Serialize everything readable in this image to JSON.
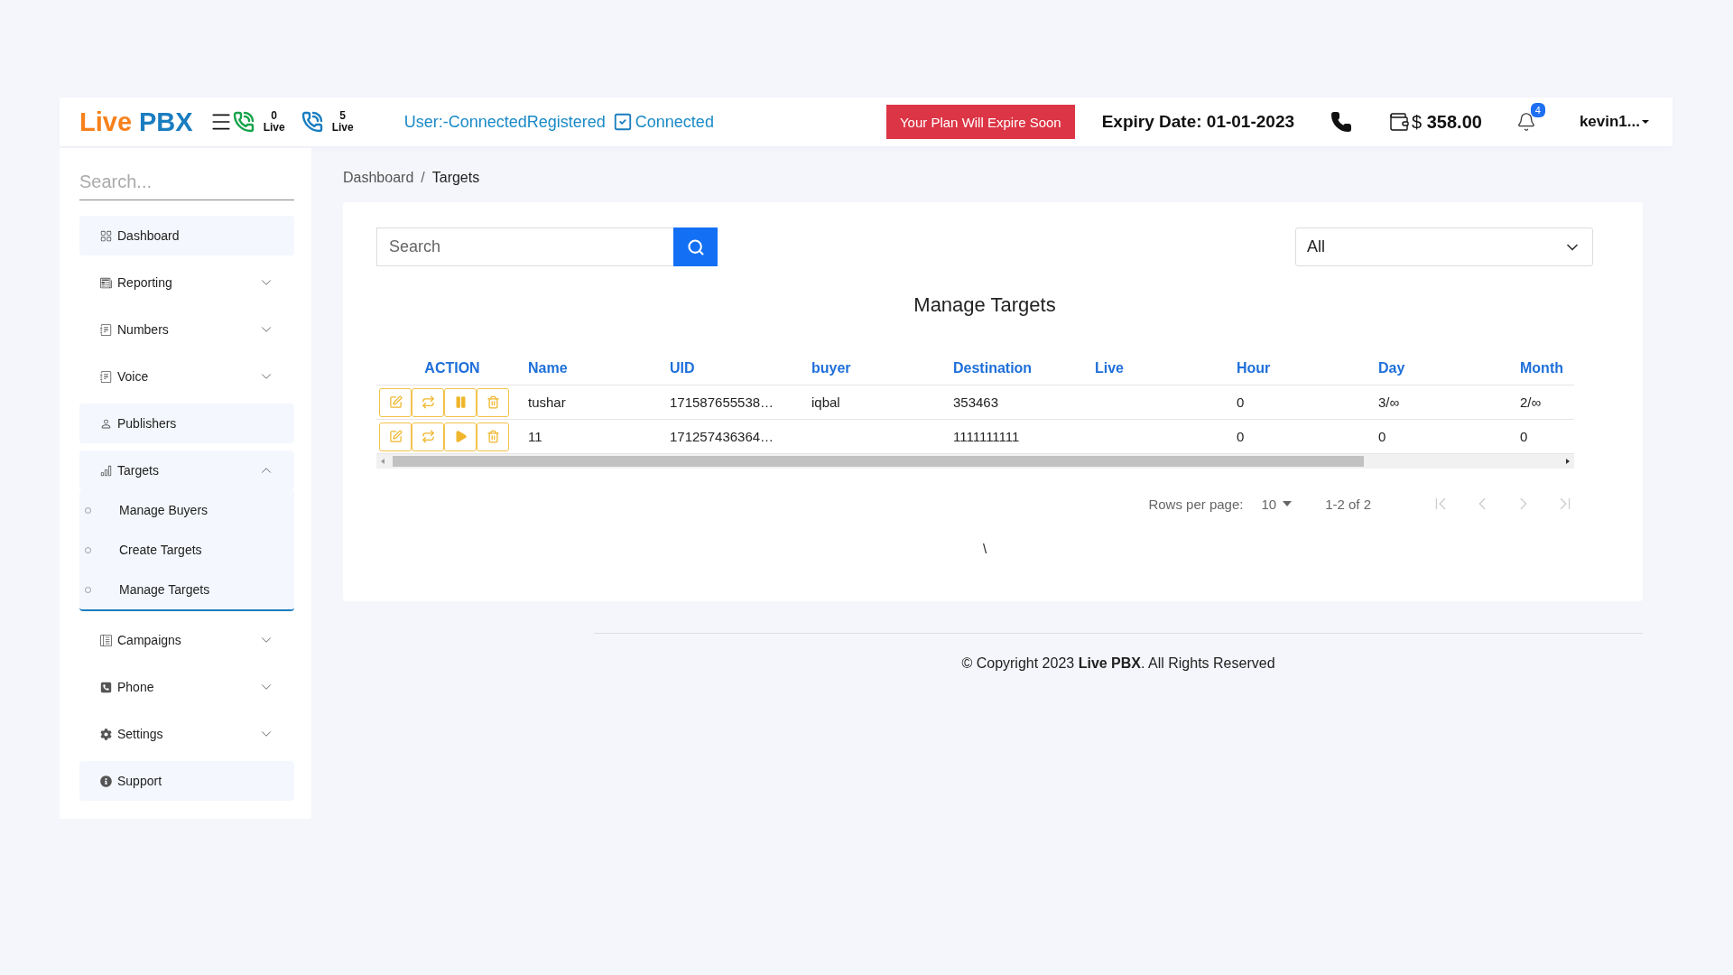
{
  "header": {
    "logo": [
      {
        "text": "Live",
        "kind": "accent"
      },
      {
        "text": "PBX",
        "kind": "main"
      }
    ],
    "live_counters": [
      {
        "count": "0",
        "label": "Live",
        "kind": "incoming"
      },
      {
        "count": "5",
        "label": "Live",
        "kind": "outgoing"
      }
    ],
    "status_text": "User:-ConnectedRegistered",
    "connection": {
      "label": "Connected",
      "checked": true
    },
    "plan_alert": "Your Plan Will Expire Soon",
    "expiry": "Expiry Date: 01-01-2023",
    "balance": {
      "currency": "$",
      "amount": "358.00"
    },
    "notifications": "4",
    "user": "kevin1..."
  },
  "sidebar": {
    "search_placeholder": "Search...",
    "items": [
      {
        "label": "Dashboard",
        "kind": "link"
      },
      {
        "label": "Reporting",
        "kind": "group",
        "expanded": false
      },
      {
        "label": "Numbers",
        "kind": "group",
        "expanded": false
      },
      {
        "label": "Voice",
        "kind": "group",
        "expanded": false
      },
      {
        "label": "Publishers",
        "kind": "link"
      },
      {
        "label": "Targets",
        "kind": "group",
        "expanded": true,
        "children": [
          {
            "label": "Manage Buyers"
          },
          {
            "label": "Create Targets"
          },
          {
            "label": "Manage Targets"
          }
        ]
      },
      {
        "label": "Campaigns",
        "kind": "group",
        "expanded": false
      },
      {
        "label": "Phone",
        "kind": "group",
        "expanded": false
      },
      {
        "label": "Settings",
        "kind": "group",
        "expanded": false
      },
      {
        "label": "Support",
        "kind": "link"
      }
    ]
  },
  "breadcrumb": {
    "separator": "/",
    "items": [
      {
        "label": "Dashboard",
        "selected": false
      },
      {
        "label": "Targets",
        "selected": true
      }
    ]
  },
  "toolbar": {
    "search_placeholder": "Search",
    "filter": "All"
  },
  "title": "Manage Targets",
  "table": {
    "columns": [
      "ACTION",
      "Name",
      "UID",
      "buyer",
      "Destination",
      "Live",
      "Hour",
      "Day",
      "Month"
    ],
    "rows": [
      {
        "playing": true,
        "cells": [
          "",
          "tushar",
          "171587655538…",
          "iqbal",
          "353463",
          "",
          "0",
          "3/∞",
          "2/∞"
        ]
      },
      {
        "playing": false,
        "cells": [
          "",
          "11",
          "171257436364…",
          "",
          "1111111111",
          "",
          "0",
          "0",
          "0"
        ]
      }
    ]
  },
  "pagination": {
    "rows_label": "Rows per page:",
    "rows_value": "10",
    "range": "1-2 of 2"
  },
  "stray_text": "\\",
  "footer": "© Copyright 2023 **Live PBX**. All Rights Reserved"
}
